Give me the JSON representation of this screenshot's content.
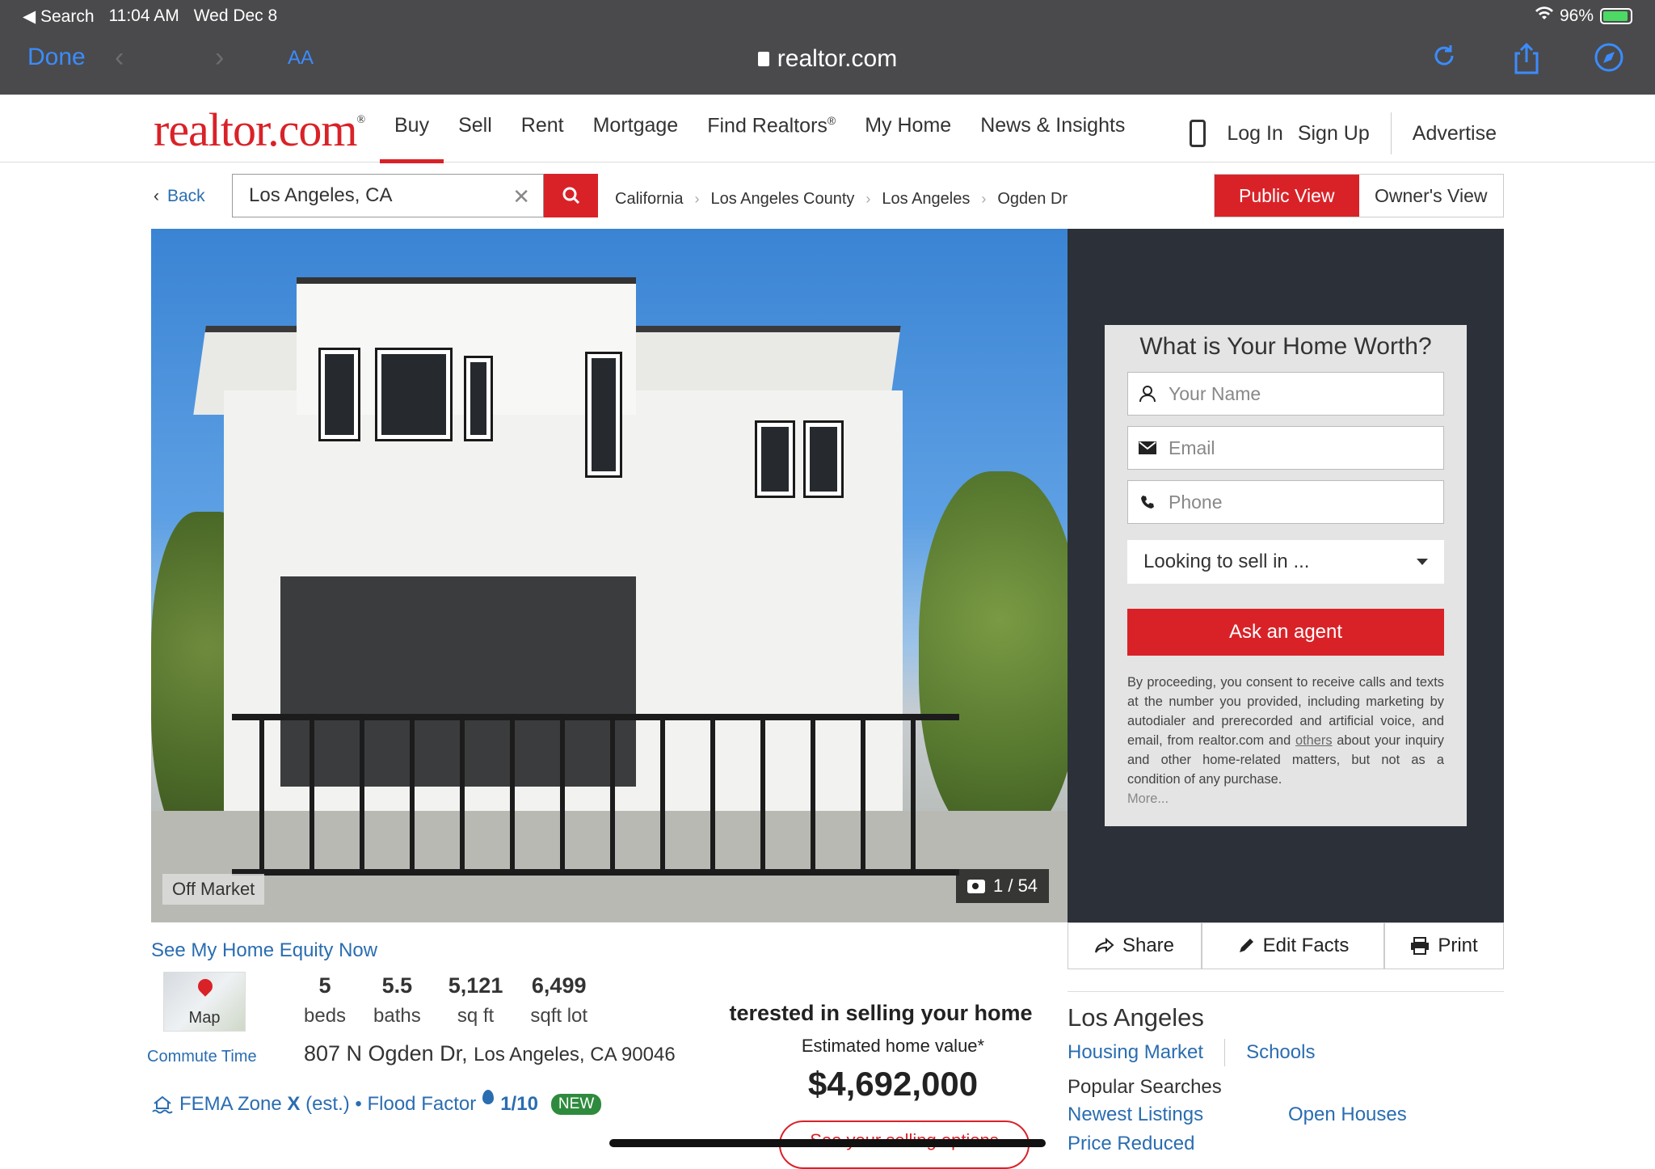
{
  "status_bar": {
    "back_app": "Search",
    "time": "11:04 AM",
    "date": "Wed Dec 8",
    "battery": "96%"
  },
  "safari": {
    "done": "Done",
    "text_size": "AA",
    "url": "realtor.com"
  },
  "header": {
    "logo": "realtor.com",
    "nav": [
      "Buy",
      "Sell",
      "Rent",
      "Mortgage",
      "Find Realtors",
      "My Home",
      "News & Insights"
    ],
    "find_realtors_mark": "®",
    "log_in": "Log In",
    "sign_up": "Sign Up",
    "advertise": "Advertise"
  },
  "search": {
    "back": "Back",
    "value": "Los Angeles, CA",
    "breadcrumb": [
      "California",
      "Los Angeles County",
      "Los Angeles",
      "Ogden Dr"
    ],
    "view_public": "Public View",
    "view_owner": "Owner's View"
  },
  "hero": {
    "status_badge": "Off Market",
    "photo_count": "1 / 54"
  },
  "worth_form": {
    "title": "What is Your Home Worth?",
    "name_placeholder": "Your Name",
    "email_placeholder": "Email",
    "phone_placeholder": "Phone",
    "sell_select": "Looking to sell in ...",
    "ask_button": "Ask an agent",
    "consent_start": "By proceeding, you consent to receive calls and texts at the number you provided, including marketing by autodialer and prerecorded and artificial voice, and email, from realtor.com and ",
    "consent_link": "others",
    "consent_end": " about your inquiry and other home-related matters, but not as a condition of any purchase.",
    "more": "More..."
  },
  "actions": {
    "share": "Share",
    "edit": "Edit Facts",
    "print": "Print"
  },
  "property": {
    "equity_link": "See My Home Equity Now",
    "map_label": "Map",
    "commute": "Commute Time",
    "stats": [
      {
        "value": "5",
        "label": "beds"
      },
      {
        "value": "5.5",
        "label": "baths"
      },
      {
        "value": "5,121",
        "label": "sq ft"
      },
      {
        "value": "6,499",
        "label": "sqft lot"
      }
    ],
    "street": "807 N Ogden Dr,",
    "city": "Los Angeles, CA 90046",
    "fema_label": "FEMA Zone",
    "fema_zone": "X",
    "fema_est": "(est.) • Flood Factor",
    "flood_score": "1/10",
    "new_badge": "NEW"
  },
  "selling": {
    "question": "terested in selling your home",
    "estimate_label": "Estimated home value*",
    "estimate_value": "$4,692,000",
    "options_link": "See your selling options"
  },
  "location": {
    "city": "Los Angeles",
    "housing_market": "Housing Market",
    "schools": "Schools",
    "popular_title": "Popular Searches",
    "popular": [
      "Newest Listings",
      "Open Houses",
      "Price Reduced"
    ]
  },
  "colors": {
    "brand_red": "#d92228",
    "link_blue": "#2a6db1",
    "safari_bar": "#4a4a4c"
  }
}
